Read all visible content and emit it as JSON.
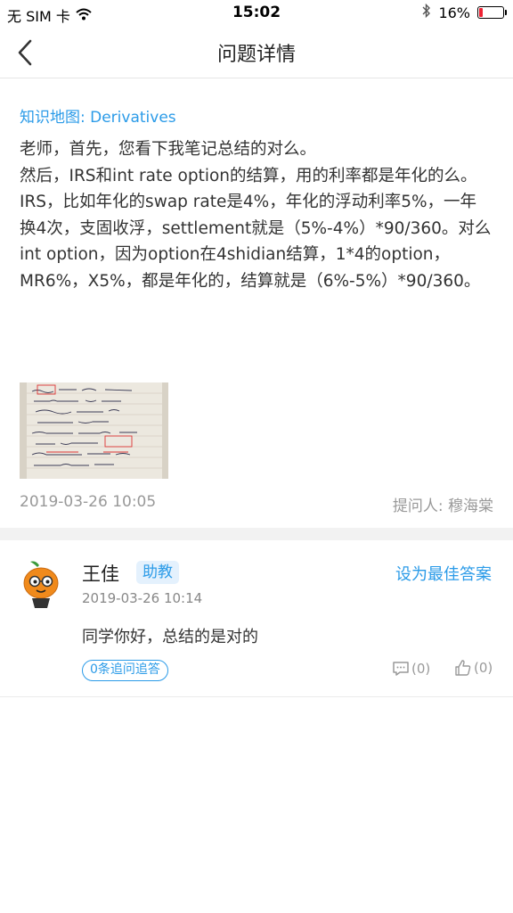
{
  "status_bar": {
    "carrier": "无 SIM 卡",
    "time": "15:02",
    "battery_percent": "16%",
    "battery_level": 0.16
  },
  "nav": {
    "title": "问题详情"
  },
  "question": {
    "knowledge_link": "知识地图: Derivatives",
    "body_lines": [
      "老师，首先，您看下我笔记总结的对么。",
      "然后，IRS和int rate option的结算，用的利率都是年化的么。",
      "IRS，比如年化的swap rate是4%，年化的浮动利率5%，一年换4次，支固收浮，settlement就是（5%-4%）*90/360。对么",
      "int option，因为option在4shidian结算，1*4的option，MR6%，X5%，都是年化的，结算就是（6%-5%）*90/360。"
    ],
    "date": "2019-03-26 10:05",
    "asker": "提问人: 穆海棠"
  },
  "answer": {
    "name": "王佳",
    "role": "助教",
    "set_best_label": "设为最佳答案",
    "date": "2019-03-26 10:14",
    "text": "同学你好，总结的是对的",
    "followup_label": "0条追问追答",
    "reply_count": "(0)",
    "like_count": "(0)"
  },
  "colors": {
    "accent": "#2b9be8",
    "muted": "#999999",
    "battery_low": "#ee2233"
  }
}
